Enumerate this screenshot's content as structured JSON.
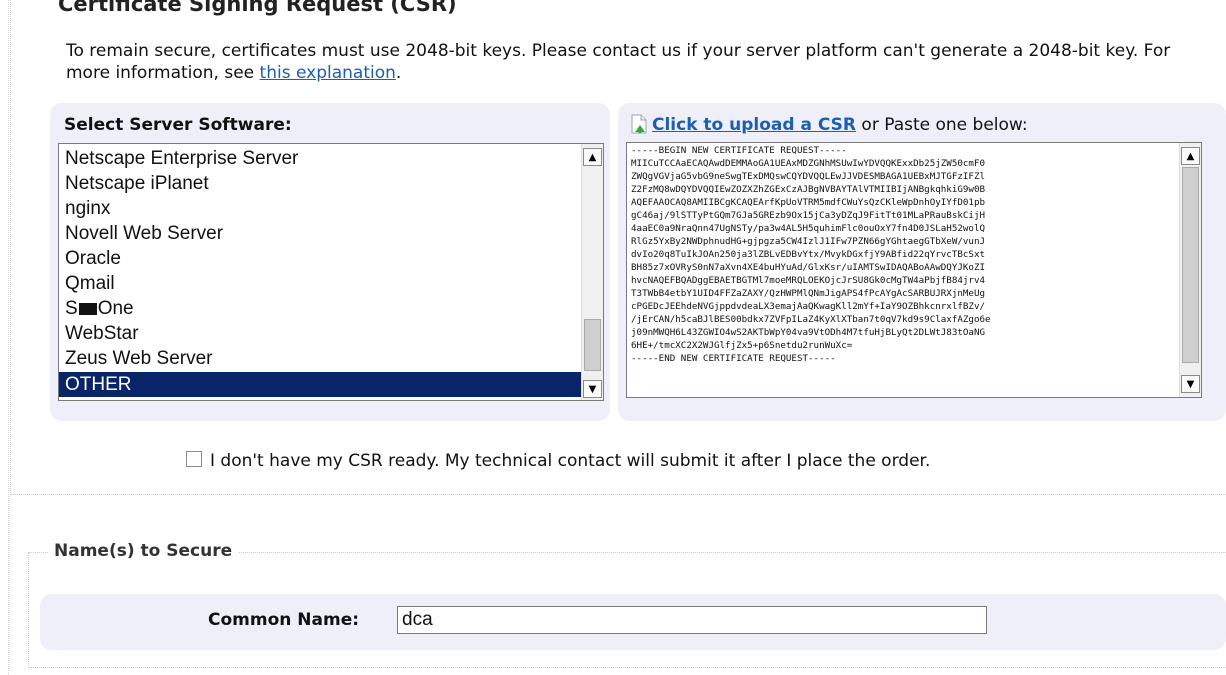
{
  "csr_section": {
    "legend": "Certificate Signing Request (CSR)",
    "intro_text": "To remain secure, certificates must use 2048-bit keys. Please contact us if your server platform can't generate a 2048-bit key. For more information, see ",
    "intro_link": "this explanation",
    "intro_end": "."
  },
  "server_software": {
    "title": "Select Server Software:",
    "options": [
      "Netscape Enterprise Server",
      "Netscape iPlanet",
      "nginx",
      "Novell Web Server",
      "Oracle",
      "Qmail",
      "S",
      "One",
      "WebStar",
      "Zeus Web Server",
      "OTHER"
    ],
    "selected": "OTHER"
  },
  "csr_input": {
    "upload_link": "Click to upload a CSR",
    "upload_suffix": " or Paste one below:",
    "content": "-----BEGIN NEW CERTIFICATE REQUEST-----\nMIICuTCCAaECAQAwdDEMMAoGA1UEAxMDZGNhMSUwIwYDVQQKExxDb25jZW50cmF0\nZWQgVGVjaG5vbG9neSwgTExDMQswCQYDVQQLEwJJVDESMBAGA1UEBxMJTGFzIFZl\nZ2FzMQ8wDQYDVQQIEwZOZXZhZGExCzAJBgNVBAYTAlVTMIIBIjANBgkqhkiG9w0B\nAQEFAAOCAQ8AMIIBCgKCAQEArfKpUoVTRM5mdfCWuYsQzCKleWpDnhOyIYfD01pb\ngC46aj/9lSTTyPtGQm7GJa5GREzb9Ox15jCa3yDZqJ9FitTt01MLaPRauBskCijH\n4aaEC0a9NraQnn47UgNSTy/pa3w4AL5H5quhimFlc0ouOxY7fn4D0JSLaH52wolQ\nRlGz5YxBy2NWDphnudHG+gjpgza5CW4IzlJ1IFw7PZN66gYGhtaegGTbXeW/vunJ\ndvIo20q8TuIkJOAn250ja3lZBLvEDBvYtx/MvykDGxfjY9ABfid22qYrvcTBcSxt\nBH85z7xOVRyS0nN7aXvn4XE4buHYuAd/GlxKsr/uIAMTSwIDAQABoAAwDQYJKoZI\nhvcNAQEFBQADggEBAETBGTMl7moeMRQLOEKOjcJrSU8Gk0cMgTW4aPbjfB84jrv4\nT3TWbB4etbY1UID4FFZaZAXY/QzHWPMlQNmJigAPS4fPcAYgAcSARBUJRXjnMeUg\ncPGEDcJEEhdeNVGjppdvdeaLX3emajAaQKwagKll2mYf+IaY9OZBhkcnrxlfBZv/\n/jErCAN/h5caBJlBES00bdkx7ZVFpILaZ4KyXlXTban7t0qV7kd9s9ClaxfAZgo6e\nj09nMWQH6L43ZGWIO4wS2AKTbWpY04va9VtODh4M7tfuHjBLyQt2DLWtJ83tOaNG\n6HE+/tmcXC2X2WJGlfjZx5+p6Snetdu2runWuXc=\n-----END NEW CERTIFICATE REQUEST-----"
  },
  "no_csr": {
    "label": "I don't have my CSR ready. My technical contact will submit it after I place the order."
  },
  "names_section": {
    "legend": "Name(s) to Secure",
    "common_name_label": "Common Name:",
    "common_name_value": "dca"
  }
}
